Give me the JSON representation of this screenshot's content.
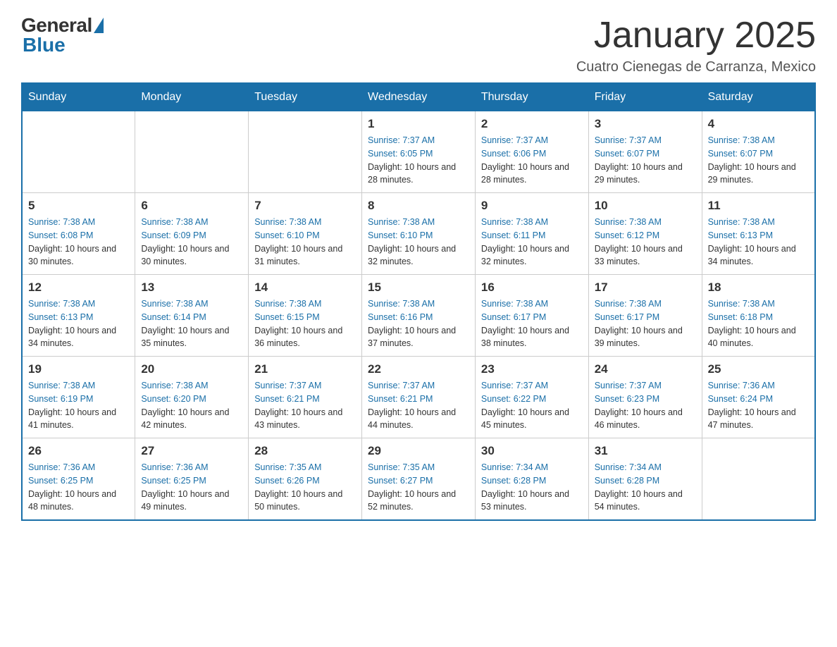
{
  "header": {
    "logo_general": "General",
    "logo_blue": "Blue",
    "month_title": "January 2025",
    "subtitle": "Cuatro Cienegas de Carranza, Mexico"
  },
  "days_of_week": [
    "Sunday",
    "Monday",
    "Tuesday",
    "Wednesday",
    "Thursday",
    "Friday",
    "Saturday"
  ],
  "weeks": [
    [
      {
        "day": "",
        "info": ""
      },
      {
        "day": "",
        "info": ""
      },
      {
        "day": "",
        "info": ""
      },
      {
        "day": "1",
        "sunrise": "7:37 AM",
        "sunset": "6:05 PM",
        "daylight": "10 hours and 28 minutes."
      },
      {
        "day": "2",
        "sunrise": "7:37 AM",
        "sunset": "6:06 PM",
        "daylight": "10 hours and 28 minutes."
      },
      {
        "day": "3",
        "sunrise": "7:37 AM",
        "sunset": "6:07 PM",
        "daylight": "10 hours and 29 minutes."
      },
      {
        "day": "4",
        "sunrise": "7:38 AM",
        "sunset": "6:07 PM",
        "daylight": "10 hours and 29 minutes."
      }
    ],
    [
      {
        "day": "5",
        "sunrise": "7:38 AM",
        "sunset": "6:08 PM",
        "daylight": "10 hours and 30 minutes."
      },
      {
        "day": "6",
        "sunrise": "7:38 AM",
        "sunset": "6:09 PM",
        "daylight": "10 hours and 30 minutes."
      },
      {
        "day": "7",
        "sunrise": "7:38 AM",
        "sunset": "6:10 PM",
        "daylight": "10 hours and 31 minutes."
      },
      {
        "day": "8",
        "sunrise": "7:38 AM",
        "sunset": "6:10 PM",
        "daylight": "10 hours and 32 minutes."
      },
      {
        "day": "9",
        "sunrise": "7:38 AM",
        "sunset": "6:11 PM",
        "daylight": "10 hours and 32 minutes."
      },
      {
        "day": "10",
        "sunrise": "7:38 AM",
        "sunset": "6:12 PM",
        "daylight": "10 hours and 33 minutes."
      },
      {
        "day": "11",
        "sunrise": "7:38 AM",
        "sunset": "6:13 PM",
        "daylight": "10 hours and 34 minutes."
      }
    ],
    [
      {
        "day": "12",
        "sunrise": "7:38 AM",
        "sunset": "6:13 PM",
        "daylight": "10 hours and 34 minutes."
      },
      {
        "day": "13",
        "sunrise": "7:38 AM",
        "sunset": "6:14 PM",
        "daylight": "10 hours and 35 minutes."
      },
      {
        "day": "14",
        "sunrise": "7:38 AM",
        "sunset": "6:15 PM",
        "daylight": "10 hours and 36 minutes."
      },
      {
        "day": "15",
        "sunrise": "7:38 AM",
        "sunset": "6:16 PM",
        "daylight": "10 hours and 37 minutes."
      },
      {
        "day": "16",
        "sunrise": "7:38 AM",
        "sunset": "6:17 PM",
        "daylight": "10 hours and 38 minutes."
      },
      {
        "day": "17",
        "sunrise": "7:38 AM",
        "sunset": "6:17 PM",
        "daylight": "10 hours and 39 minutes."
      },
      {
        "day": "18",
        "sunrise": "7:38 AM",
        "sunset": "6:18 PM",
        "daylight": "10 hours and 40 minutes."
      }
    ],
    [
      {
        "day": "19",
        "sunrise": "7:38 AM",
        "sunset": "6:19 PM",
        "daylight": "10 hours and 41 minutes."
      },
      {
        "day": "20",
        "sunrise": "7:38 AM",
        "sunset": "6:20 PM",
        "daylight": "10 hours and 42 minutes."
      },
      {
        "day": "21",
        "sunrise": "7:37 AM",
        "sunset": "6:21 PM",
        "daylight": "10 hours and 43 minutes."
      },
      {
        "day": "22",
        "sunrise": "7:37 AM",
        "sunset": "6:21 PM",
        "daylight": "10 hours and 44 minutes."
      },
      {
        "day": "23",
        "sunrise": "7:37 AM",
        "sunset": "6:22 PM",
        "daylight": "10 hours and 45 minutes."
      },
      {
        "day": "24",
        "sunrise": "7:37 AM",
        "sunset": "6:23 PM",
        "daylight": "10 hours and 46 minutes."
      },
      {
        "day": "25",
        "sunrise": "7:36 AM",
        "sunset": "6:24 PM",
        "daylight": "10 hours and 47 minutes."
      }
    ],
    [
      {
        "day": "26",
        "sunrise": "7:36 AM",
        "sunset": "6:25 PM",
        "daylight": "10 hours and 48 minutes."
      },
      {
        "day": "27",
        "sunrise": "7:36 AM",
        "sunset": "6:25 PM",
        "daylight": "10 hours and 49 minutes."
      },
      {
        "day": "28",
        "sunrise": "7:35 AM",
        "sunset": "6:26 PM",
        "daylight": "10 hours and 50 minutes."
      },
      {
        "day": "29",
        "sunrise": "7:35 AM",
        "sunset": "6:27 PM",
        "daylight": "10 hours and 52 minutes."
      },
      {
        "day": "30",
        "sunrise": "7:34 AM",
        "sunset": "6:28 PM",
        "daylight": "10 hours and 53 minutes."
      },
      {
        "day": "31",
        "sunrise": "7:34 AM",
        "sunset": "6:28 PM",
        "daylight": "10 hours and 54 minutes."
      },
      {
        "day": "",
        "info": ""
      }
    ]
  ],
  "labels": {
    "sunrise_label": "Sunrise:",
    "sunset_label": "Sunset:",
    "daylight_label": "Daylight:"
  }
}
